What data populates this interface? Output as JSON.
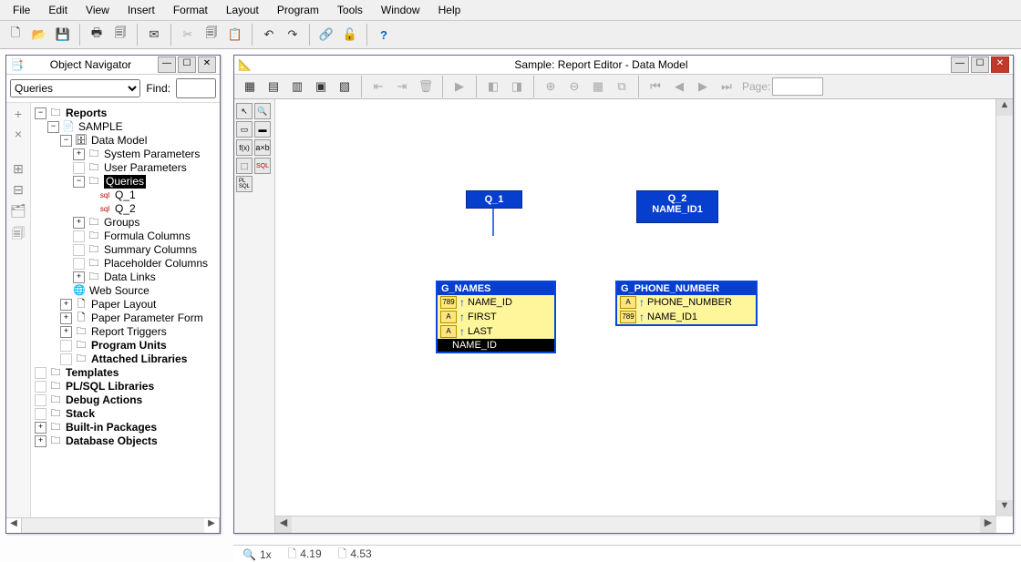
{
  "menu": [
    "File",
    "Edit",
    "View",
    "Insert",
    "Format",
    "Layout",
    "Program",
    "Tools",
    "Window",
    "Help"
  ],
  "nav_window": {
    "title": "Object Navigator",
    "dropdown_selected": "Queries",
    "find_label": "Find:",
    "find_value": ""
  },
  "tree": {
    "reports": "Reports",
    "sample": "SAMPLE",
    "data_model": "Data Model",
    "system_params": "System Parameters",
    "user_params": "User Parameters",
    "queries": "Queries",
    "q1": "Q_1",
    "q2": "Q_2",
    "groups": "Groups",
    "formula": "Formula Columns",
    "summary": "Summary Columns",
    "placeholder": "Placeholder Columns",
    "datalinks": "Data Links",
    "websource": "Web Source",
    "paperlayout": "Paper Layout",
    "paperparam": "Paper Parameter Form",
    "reporttriggers": "Report Triggers",
    "programunits": "Program Units",
    "attachedlibs": "Attached Libraries",
    "templates": "Templates",
    "plsql": "PL/SQL Libraries",
    "debug": "Debug Actions",
    "stack": "Stack",
    "builtins": "Built-in Packages",
    "dbobjects": "Database Objects"
  },
  "editor_window": {
    "title": "Sample: Report Editor - Data Model",
    "page_label": "Page:",
    "page_value": ""
  },
  "model": {
    "q1": "Q_1",
    "q2_line1": "Q_2",
    "q2_line2": "NAME_ID1",
    "g1_head": "G_NAMES",
    "g1_r1": "NAME_ID",
    "g1_r2": "FIRST",
    "g1_r3": "LAST",
    "g1_r4": "NAME_ID",
    "g2_head": "G_PHONE_NUMBER",
    "g2_r1": "PHONE_NUMBER",
    "g2_r2": "NAME_ID1"
  },
  "status": {
    "zoom": "1x",
    "coord1": "4.19",
    "coord2": "4.53"
  }
}
